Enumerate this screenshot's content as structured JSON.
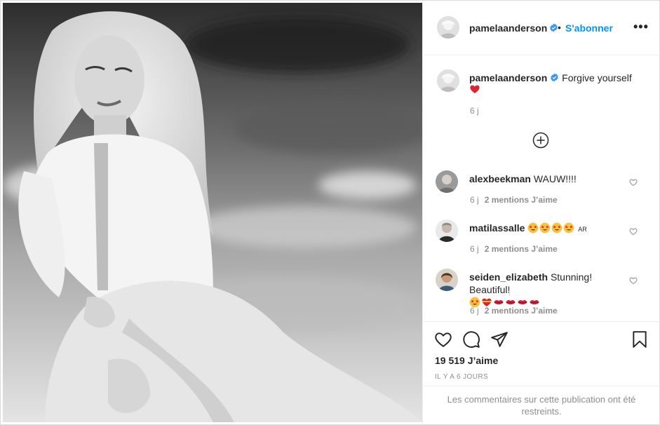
{
  "post": {
    "author": "pamelaanderson",
    "follow_label": "S'abonner",
    "separator": "•",
    "more_label": "•••"
  },
  "caption": {
    "username": "pamelaanderson",
    "text": "Forgive yourself",
    "emoji": "red-heart",
    "time": "6 j"
  },
  "comments": [
    {
      "username": "alexbeekman",
      "text": "WAUW!!!!",
      "emojis": [],
      "suffix": "",
      "time": "6 j",
      "likes": "2 mentions J’aime"
    },
    {
      "username": "matilassalle",
      "text": "",
      "emojis": [
        "star-struck",
        "star-struck",
        "star-struck",
        "star-struck"
      ],
      "suffix": "AR",
      "time": "6 j",
      "likes": "2 mentions J’aime"
    },
    {
      "username": "seiden_elizabeth",
      "text": "Stunning! Beautiful!",
      "emojis": [
        "star-struck",
        "heart-with-ribbon",
        "lips",
        "lips",
        "lips",
        "lips"
      ],
      "suffix": "",
      "time": "6 j",
      "likes": "2 mentions J’aime"
    }
  ],
  "stats": {
    "likes": "19 519 J’aime",
    "posted": "IL Y A 6 JOURS"
  },
  "restricted_notice": "Les commentaires sur cette publication ont été restreints.",
  "colors": {
    "link": "#0095f6",
    "text": "#262626",
    "muted": "#8e8e8e",
    "border": "#dbdbdb",
    "heart": "#ed4956"
  },
  "icons": [
    "verified-badge-icon",
    "more-options-icon",
    "load-more-comments-icon",
    "heart-icon",
    "comment-icon",
    "share-icon",
    "bookmark-icon",
    "comment-like-icon"
  ]
}
